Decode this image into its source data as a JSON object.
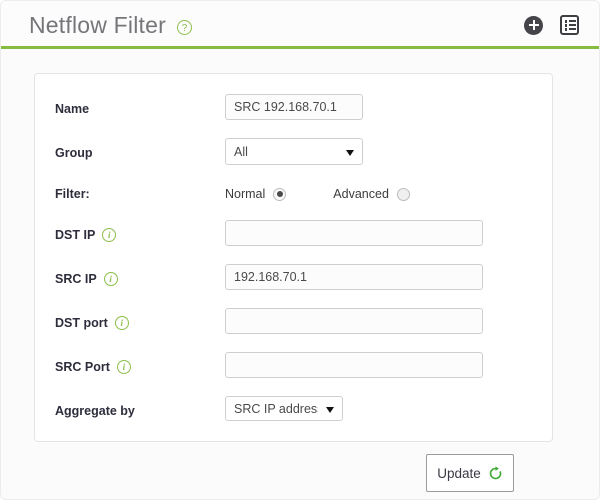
{
  "header": {
    "title": "Netflow Filter",
    "help_icon": "question-circle-icon",
    "help_glyph": "?",
    "add_icon": "add-circle-icon",
    "report_icon": "report-list-icon",
    "accent_color": "#85bb40",
    "title_color": "#76767a"
  },
  "form": {
    "rows": [
      {
        "label": "Name",
        "value": "SRC 192.168.70.1",
        "placeholder": ""
      },
      {
        "label": "Group",
        "value": "All",
        "options": [
          "All"
        ]
      },
      {
        "label": "Filter:",
        "options": [
          {
            "label": "Normal",
            "checked": true
          },
          {
            "label": "Advanced",
            "checked": false
          }
        ]
      },
      {
        "label": "DST IP",
        "value": "",
        "placeholder": "",
        "info": true
      },
      {
        "label": "SRC IP",
        "value": "192.168.70.1",
        "placeholder": "",
        "info": true
      },
      {
        "label": "DST port",
        "value": "",
        "placeholder": "",
        "info": true
      },
      {
        "label": "SRC Port",
        "value": "",
        "placeholder": "",
        "info": true
      },
      {
        "label": "Aggregate by",
        "value": "SRC IP address",
        "options": [
          "SRC IP address"
        ]
      }
    ],
    "info_glyph": "i"
  },
  "footer": {
    "update_label": "Update",
    "refresh_icon": "refresh-circle-icon",
    "refresh_color": "#3faa35"
  }
}
